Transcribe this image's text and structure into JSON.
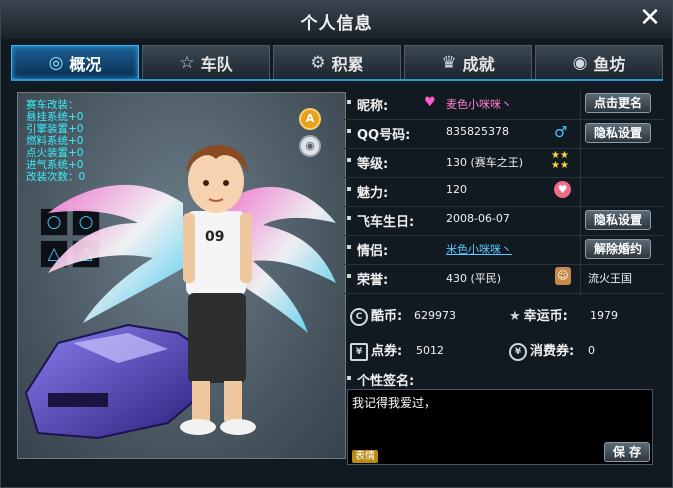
{
  "window": {
    "title": "个人信息",
    "close_glyph": "✕"
  },
  "tabs": [
    {
      "label": "概况",
      "icon": "overview-icon",
      "active": true
    },
    {
      "label": "车队",
      "icon": "star-icon",
      "active": false
    },
    {
      "label": "积累",
      "icon": "gear-icon",
      "active": false
    },
    {
      "label": "成就",
      "icon": "achievement-icon",
      "active": false
    },
    {
      "label": "鱼坊",
      "icon": "fish-icon",
      "active": false
    }
  ],
  "avatar": {
    "stats_lines": [
      "赛车改装：",
      "悬挂系统+0",
      "引擎装置+0",
      "燃料系统+0",
      "点火装置+0",
      "进气系统+0",
      "改装次数：0"
    ],
    "slot_symbols": [
      "○",
      "○",
      "△",
      "△"
    ],
    "side_icon_a": "A"
  },
  "profile": {
    "nickname_label": "昵称:",
    "nickname_value": "麦色小咪咪丶",
    "rename_button": "点击更名",
    "qq_label": "QQ号码:",
    "qq_value": "835825378",
    "privacy_button": "隐私设置",
    "level_label": "等级:",
    "level_value": "130 (赛车之王)",
    "charm_label": "魅力:",
    "charm_value": "120",
    "birthday_label": "飞车生日:",
    "birthday_value": "2008-06-07",
    "privacy_button2": "隐私设置",
    "partner_label": "情侣:",
    "partner_value": "米色小咪咪丶",
    "divorce_button": "解除婚约",
    "honor_label": "荣誉:",
    "honor_value": "430 (平民)",
    "honor_title": "流火王国"
  },
  "currency": {
    "coolcoin_label": "酷币:",
    "coolcoin_value": "629973",
    "lucky_label": "幸运币:",
    "lucky_value": "1979",
    "ticket_label": "点券:",
    "ticket_value": "5012",
    "consume_label": "消费券:",
    "consume_value": "0"
  },
  "signature": {
    "label": "个性签名:",
    "text": "我记得我爱过，",
    "emoji_button": "表情",
    "save_button": "保 存"
  },
  "colors": {
    "accent": "#2aa8f0",
    "nickname": "#ff7fd0",
    "partner": "#5ec8ff",
    "stats": "#38f0ff"
  }
}
